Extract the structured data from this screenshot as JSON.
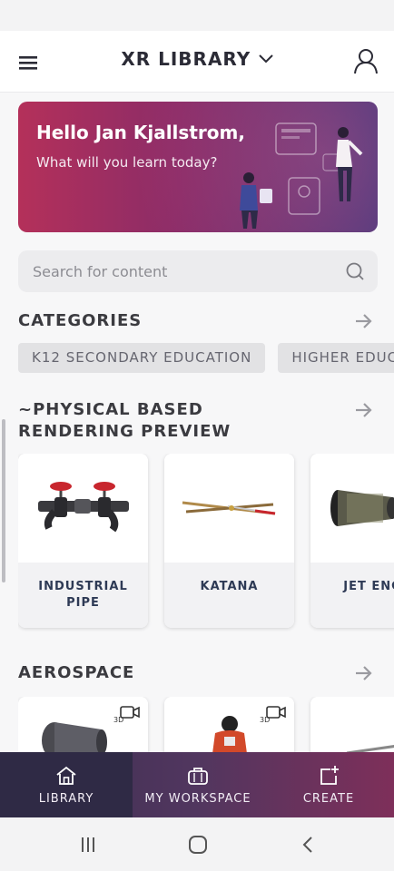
{
  "header": {
    "title": "XR LIBRARY"
  },
  "hero": {
    "greeting": "Hello Jan Kjallstrom,",
    "subtitle": "What will you learn today?"
  },
  "search": {
    "placeholder": "Search for content"
  },
  "categories": {
    "title": "CATEGORIES",
    "chips": [
      "K12 SECONDARY EDUCATION",
      "HIGHER EDUCA"
    ]
  },
  "pbr": {
    "title": "~PHYSICAL BASED RENDERING PREVIEW",
    "cards": [
      {
        "label": "INDUSTRIAL PIPE",
        "icon": "industrial-pipe"
      },
      {
        "label": "KATANA",
        "icon": "katana"
      },
      {
        "label": "JET ENGI",
        "icon": "jet-engine"
      }
    ]
  },
  "aerospace": {
    "title": "AEROSPACE",
    "cards": [
      {
        "badge": "3D",
        "icon": "turbine"
      },
      {
        "badge": "3D",
        "icon": "astronaut"
      },
      {
        "badge": "",
        "icon": "aircraft"
      }
    ]
  },
  "bottom_nav": {
    "items": [
      {
        "label": "LIBRARY",
        "icon": "home-icon",
        "active": true
      },
      {
        "label": "MY WORKSPACE",
        "icon": "briefcase-icon",
        "active": false
      },
      {
        "label": "CREATE",
        "icon": "add-card-icon",
        "active": false
      }
    ]
  },
  "colors": {
    "accent_pink": "#b4305a",
    "accent_purple": "#47357a",
    "nav_dark": "#2f2a45"
  }
}
